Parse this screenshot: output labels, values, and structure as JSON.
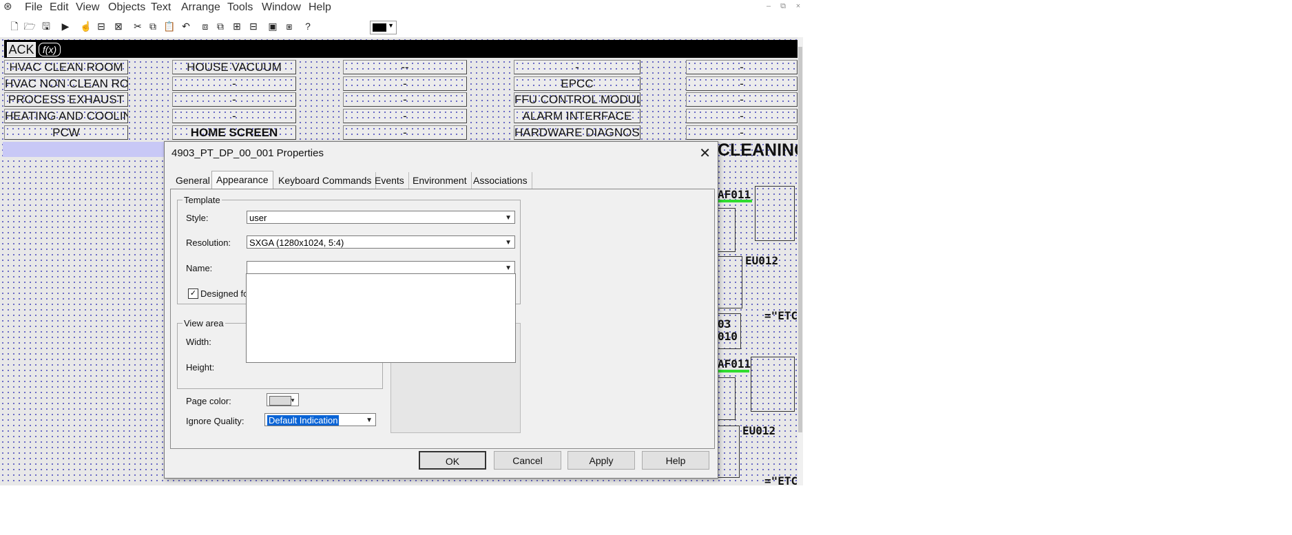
{
  "menubar": {
    "items": [
      "File",
      "Edit",
      "View",
      "Objects",
      "Text",
      "Arrange",
      "Tools",
      "Window",
      "Help"
    ],
    "window_controls": [
      "–",
      "⧉",
      "×"
    ]
  },
  "toolbar": {
    "icons": [
      "new-icon",
      "open-icon",
      "save-icon",
      "run-icon",
      "hand-icon",
      "properties-icon",
      "edit-icon",
      "cut-icon",
      "copy-icon",
      "paste-icon",
      "undo-icon",
      "bring-front-icon",
      "send-back-icon",
      "group-icon",
      "ungroup-icon",
      "align-icon",
      "resize-icon",
      "help-icon"
    ],
    "glyphs": [
      "🗋",
      "🗁",
      "🖫",
      "▶",
      "☝",
      "⊟",
      "⊠",
      "✂",
      "⧉",
      "📋",
      "↶",
      "⧈",
      "⧉",
      "⊞",
      "⊟",
      "▣",
      "⧆",
      "?"
    ],
    "color_value": "#000000"
  },
  "header": {
    "ack_label": "ACK",
    "fx_label": "f(x)"
  },
  "nav": {
    "col1": [
      "HVAC CLEAN ROOM",
      "HVAC NON CLEAN ROOM",
      "PROCESS EXHAUST",
      "HEATING AND COOLING",
      "PCW"
    ],
    "col2": [
      "HOUSE VACUUM",
      "-",
      "-",
      "-",
      "HOME SCREEN"
    ],
    "col3": [
      "--",
      "-",
      "-",
      "-",
      "-"
    ],
    "col4": [
      "-",
      "EPCC",
      "FFU CONTROL MODULE",
      "ALARM INTERFACE",
      "HARDWARE DIAGNOSTIC"
    ],
    "col5": [
      "-",
      "-",
      "-",
      "-",
      "-"
    ]
  },
  "background": {
    "cleaning_title": "CLEANING",
    "labels": [
      "AF011",
      "EU012",
      "03",
      "010",
      "AF011",
      "EU012",
      "=\"ETC",
      "=\"ETC"
    ]
  },
  "dialog": {
    "title": "4903_PT_DP_00_001 Properties",
    "tabs": [
      "General",
      "Appearance",
      "Keyboard Commands",
      "Events",
      "Environment",
      "Associations"
    ],
    "selected_tab": "Appearance",
    "template_group": "Template",
    "style_label": "Style:",
    "style_value": "user",
    "resolution_label": "Resolution:",
    "resolution_value": "SXGA (1280x1024, 5:4)",
    "name_label": "Name:",
    "name_value": "",
    "designed_label": "Designed fo",
    "designed_checked": "✓",
    "view_area_group": "View area",
    "width_label": "Width:",
    "height_label": "Height:",
    "page_color_label": "Page color:",
    "page_color_value": "#d9d9d9",
    "ignore_quality_label": "Ignore Quality:",
    "ignore_quality_value": "Default Indication",
    "buttons": {
      "ok": "OK",
      "cancel": "Cancel",
      "apply": "Apply",
      "help": "Help"
    }
  }
}
